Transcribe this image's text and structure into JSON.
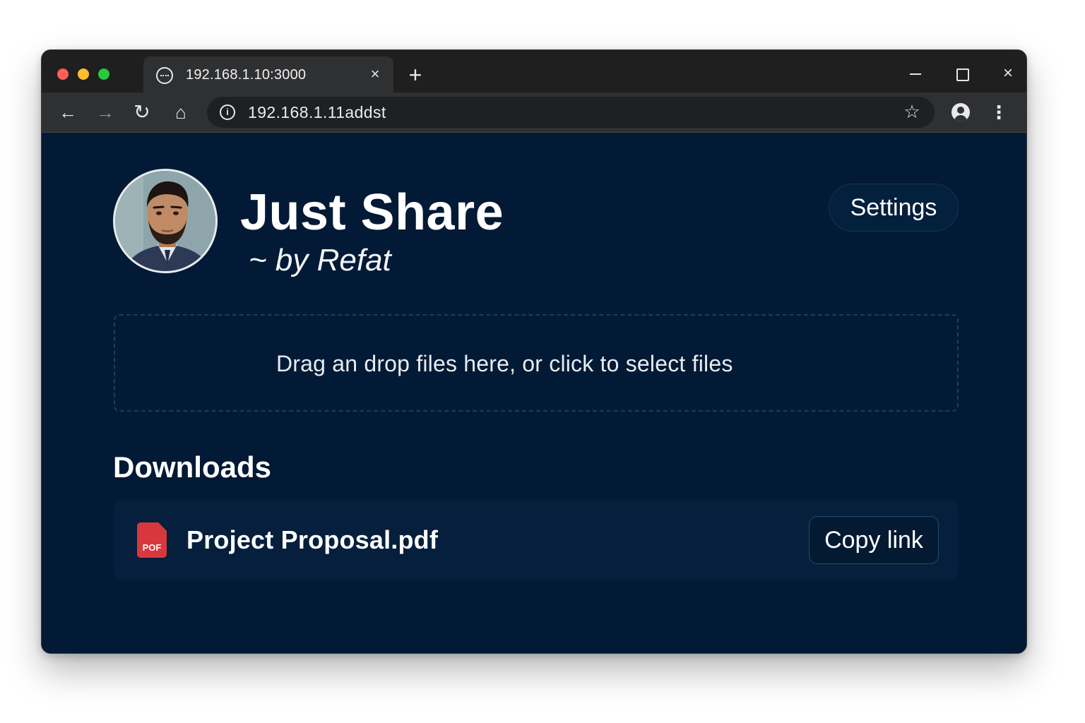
{
  "browser": {
    "tab_title": "192.168.1.10:3000",
    "tab_close_icon": "×",
    "new_tab_icon": "+",
    "window_close_icon": "×",
    "back_icon": "←",
    "forward_icon": "→",
    "reload_icon": "↻",
    "home_icon": "⌂",
    "info_icon": "i",
    "bookmark_icon": "☆",
    "menu_icon": "⋮",
    "address": "192.168.1.11addst"
  },
  "header": {
    "title": "Just Share",
    "subtitle": "~ by Refat",
    "settings_label": "Settings"
  },
  "dropzone": {
    "text": "Drag an drop files here, or click to select files"
  },
  "downloads": {
    "heading": "Downloads",
    "items": [
      {
        "file_type_label": "POF",
        "name": "Project Proposal.pdf",
        "action_label": "Copy link"
      }
    ]
  },
  "colors": {
    "page_background": "#021a35",
    "pdf_icon": "#d8383d",
    "traffic_red": "#fe5f57",
    "traffic_yellow": "#febc2e",
    "traffic_green": "#28c840"
  }
}
